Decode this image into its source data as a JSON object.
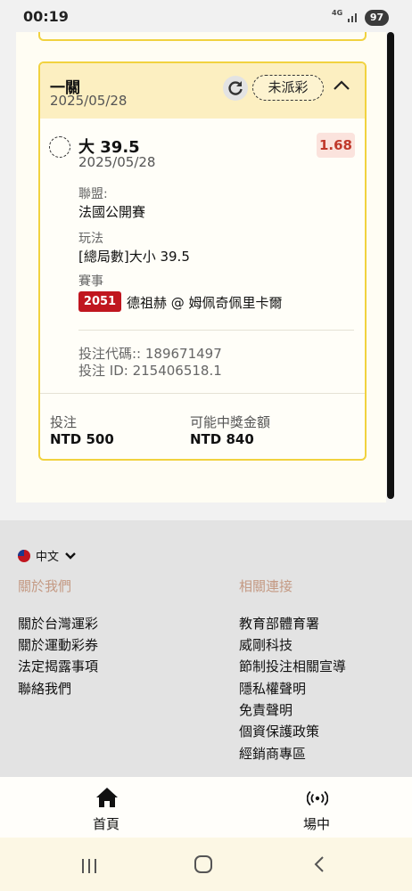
{
  "status_bar": {
    "time": "00:19",
    "network": "4G",
    "battery": "97"
  },
  "bet_card": {
    "title": "一關",
    "date": "2025/05/28",
    "status": "未派彩",
    "selection": {
      "name": "大 39.5",
      "date": "2025/05/28",
      "odds": "1.68",
      "league_label": "聯盟:",
      "league": "法國公開賽",
      "market_label": "玩法",
      "market": "[總局數]大小 39.5",
      "event_label": "賽事",
      "event_id": "2051",
      "event_name": "德祖赫 @ 姆佩奇佩里卡爾",
      "bet_code": "投注代碼:: 189671497",
      "bet_id": "投注 ID: 215406518.1"
    },
    "stake_label": "投注",
    "stake": "NTD 500",
    "payout_label": "可能中獎金額",
    "payout": "NTD 840"
  },
  "footer": {
    "language": "中文",
    "about_heading": "關於我們",
    "about_links": [
      "關於台灣運彩",
      "關於運動彩券",
      "法定揭露事項",
      "聯絡我們"
    ],
    "related_heading": "相關連接",
    "related_links": [
      "教育部體育署",
      "威剛科技",
      "節制投注相關宣導",
      "隱私權聲明",
      "免責聲明",
      "個資保護政策",
      "經銷商專區"
    ]
  },
  "bottom_nav": {
    "home": "首頁",
    "live": "場中"
  },
  "colors": {
    "accent": "#f1d23f",
    "odds_red": "#c0392b",
    "event_badge": "#c0161f",
    "link_heading": "#c49a84"
  }
}
